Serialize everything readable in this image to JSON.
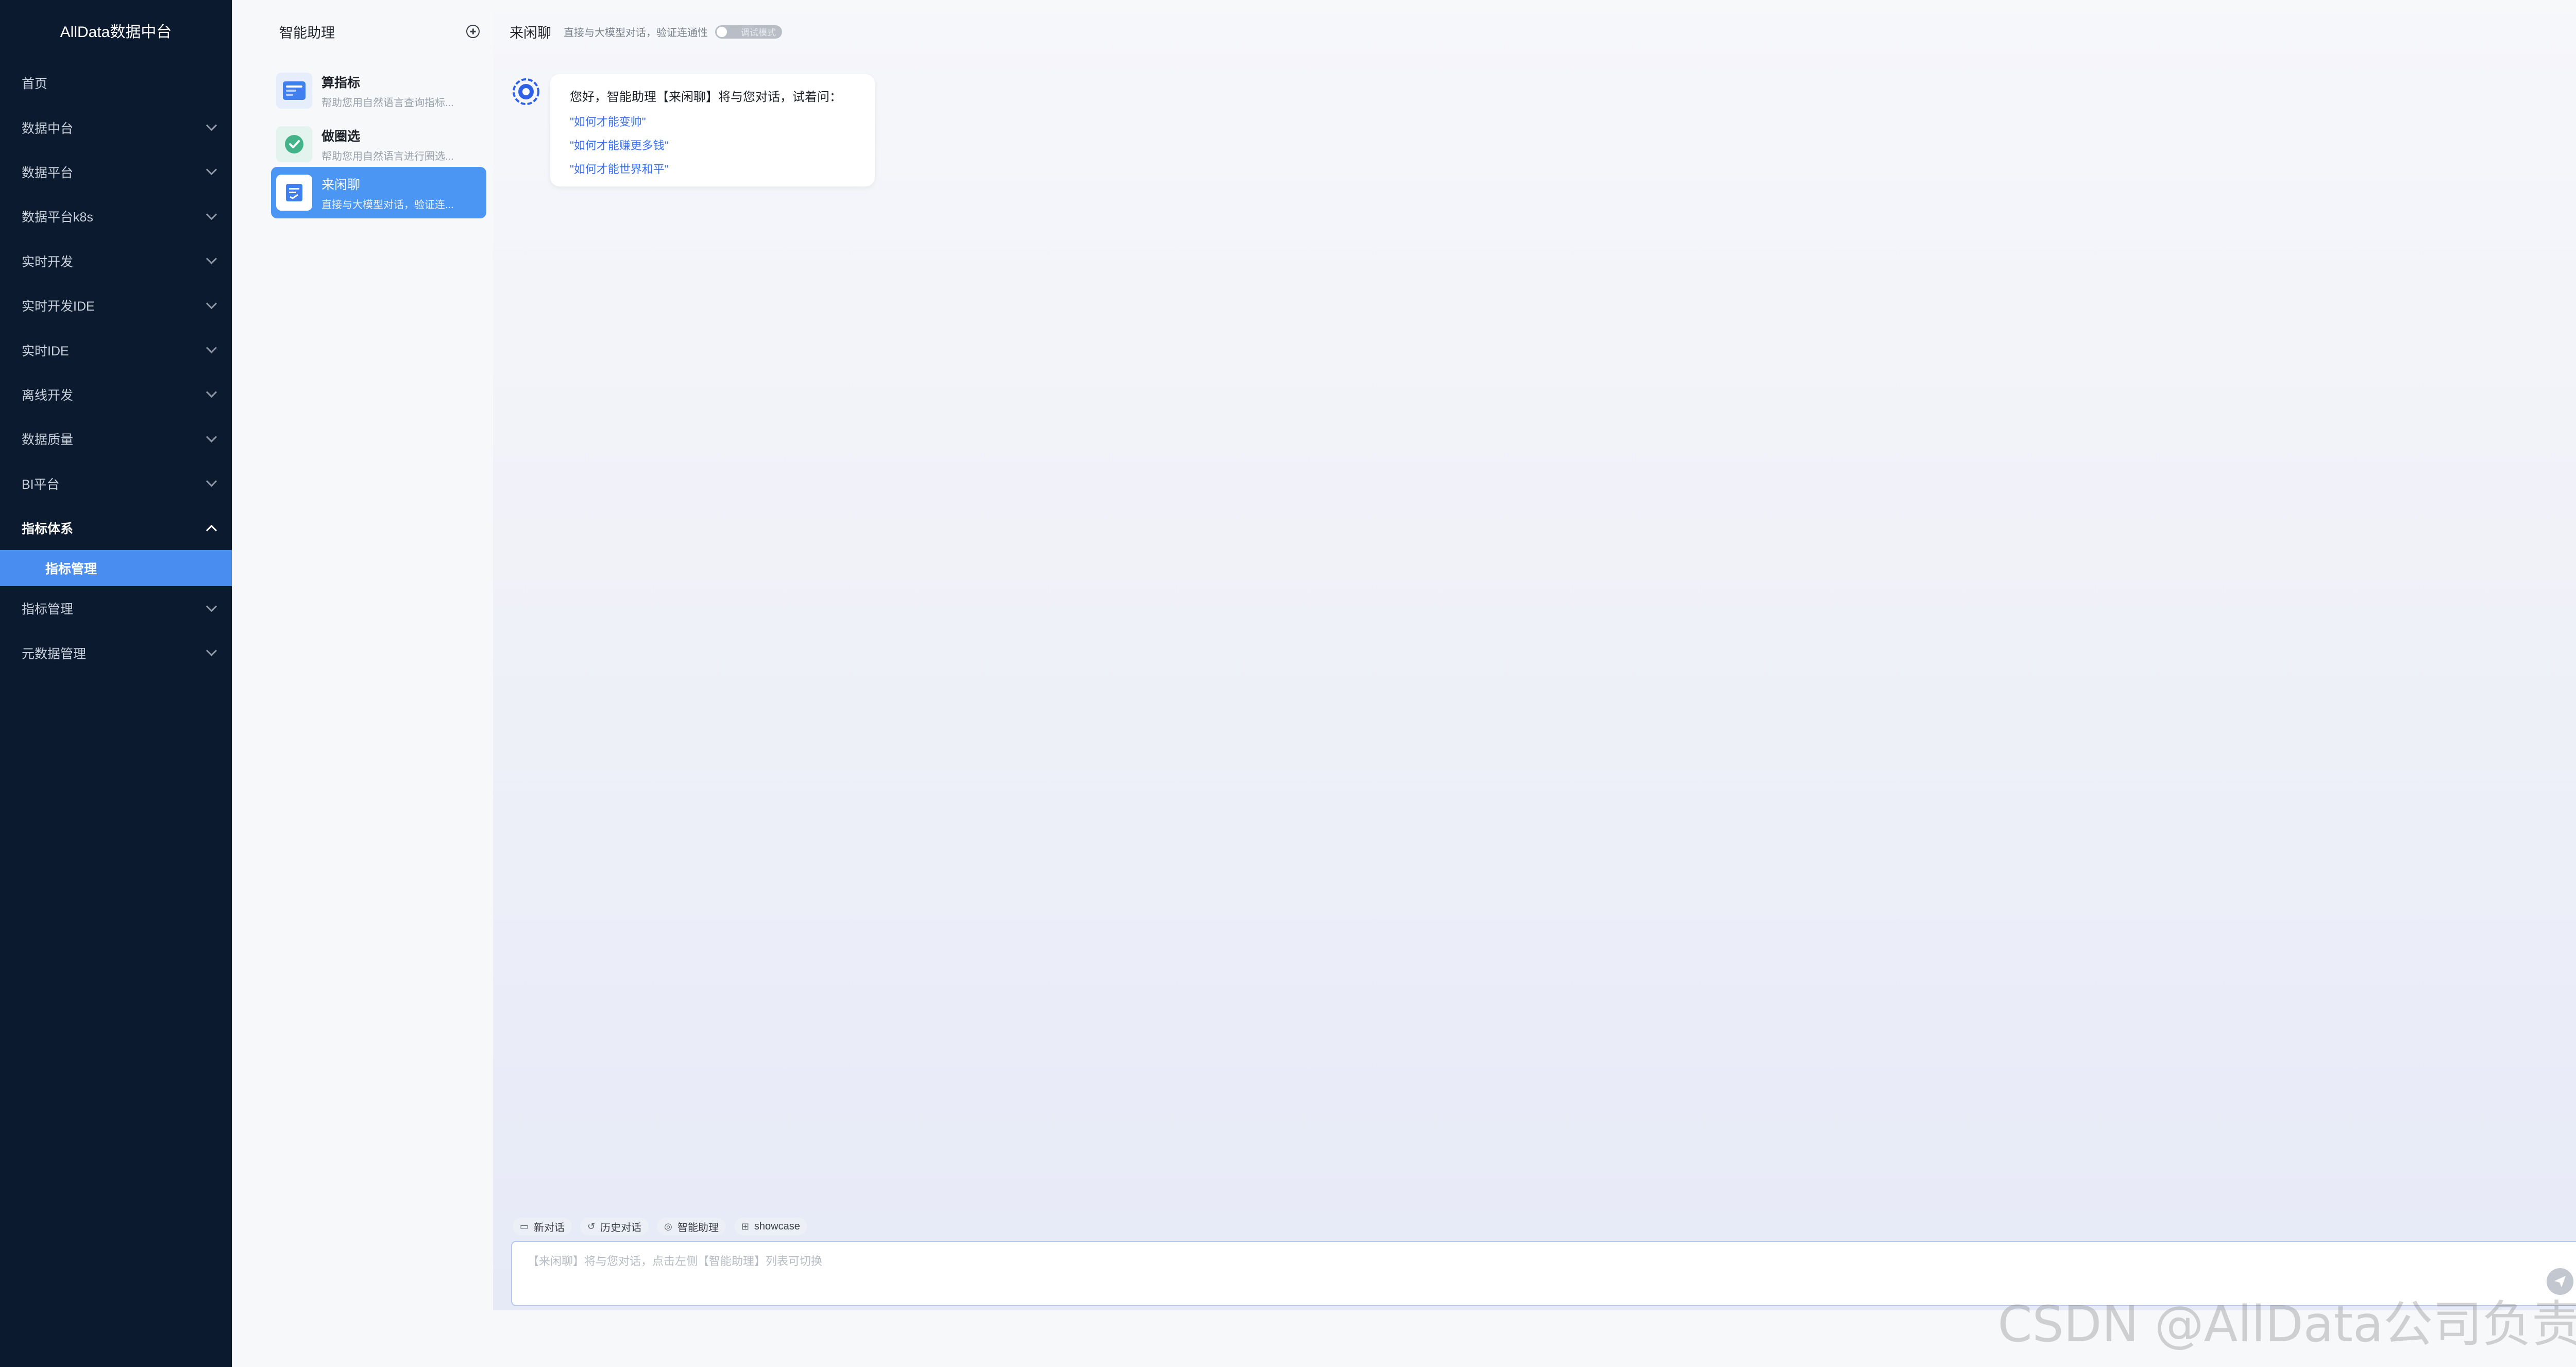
{
  "nav": {
    "brand": "AllData数据中台",
    "items": [
      {
        "label": "首页"
      },
      {
        "label": "数据中台"
      },
      {
        "label": "数据平台"
      },
      {
        "label": "数据平台k8s"
      },
      {
        "label": "实时开发"
      },
      {
        "label": "实时开发IDE"
      },
      {
        "label": "实时IDE"
      },
      {
        "label": "离线开发"
      },
      {
        "label": "数据质量"
      },
      {
        "label": "BI平台"
      },
      {
        "label": "指标体系"
      },
      {
        "label": "指标管理"
      },
      {
        "label": "指标管理"
      },
      {
        "label": "元数据管理"
      }
    ]
  },
  "assistant": {
    "title": "智能助理",
    "agents": [
      {
        "name": "算指标",
        "desc": "帮助您用自然语言查询指标..."
      },
      {
        "name": "做圈选",
        "desc": "帮助您用自然语言进行圈选..."
      },
      {
        "name": "来闲聊",
        "desc": "直接与大模型对话，验证连..."
      }
    ]
  },
  "chat": {
    "title": "来闲聊",
    "subtitle": "直接与大模型对话，验证连通性",
    "toggle_label": "调试模式",
    "greeting": "您好，智能助理【来闲聊】将与您对话，试着问：",
    "suggestions": [
      "\"如何才能变帅\"",
      "\"如何才能赚更多钱\"",
      "\"如何才能世界和平\""
    ],
    "tools": [
      "新对话",
      "历史对话",
      "智能助理",
      "showcase"
    ],
    "input_placeholder": "【来闲聊】将与您对话，点击左侧【智能助理】列表可切换"
  },
  "watermark": "CSDN @AllData公司负责人"
}
